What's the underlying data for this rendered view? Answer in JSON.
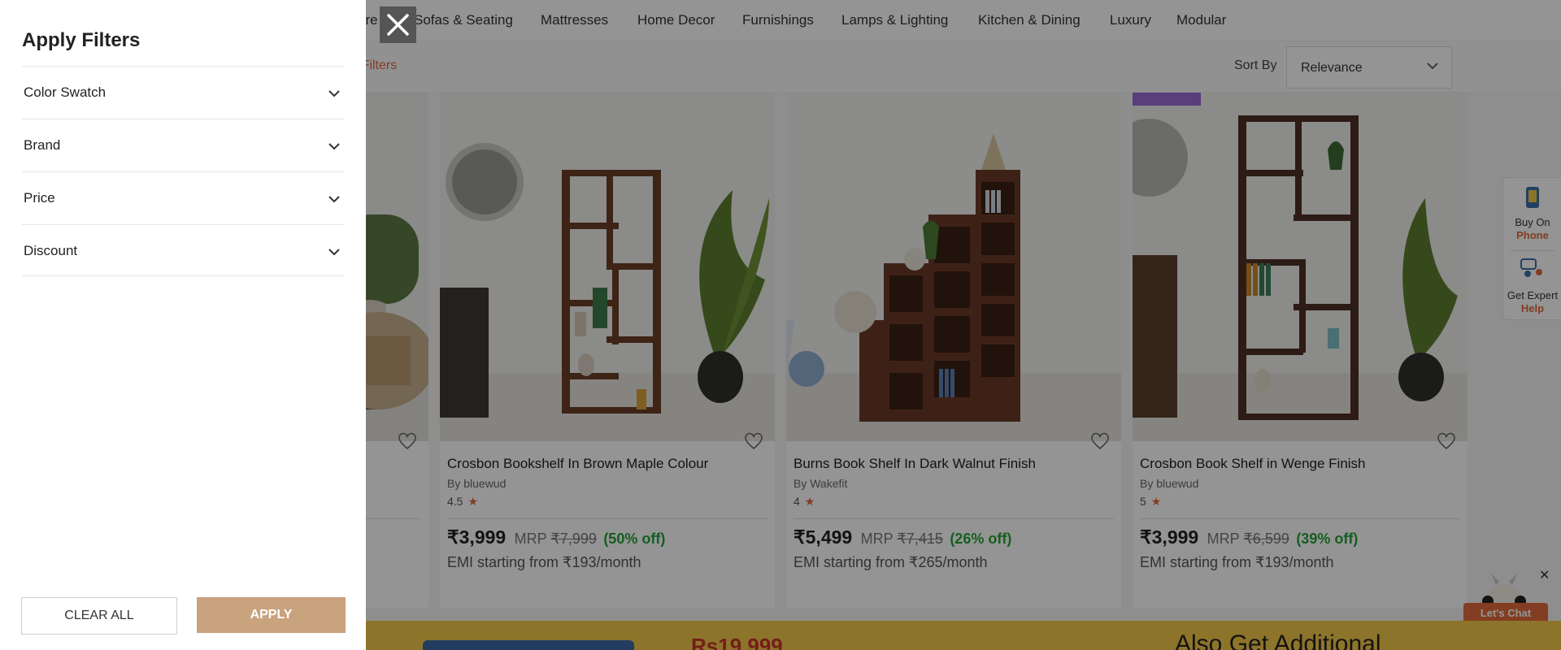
{
  "nav": {
    "items": [
      "ure",
      "Sofas & Seating",
      "Mattresses",
      "Home Decor",
      "Furnishings",
      "Lamps & Lighting",
      "Kitchen & Dining",
      "Luxury",
      "Modular"
    ]
  },
  "toolbar": {
    "more_filters": "re Filters",
    "sort_by_label": "Sort By",
    "sort_by_value": "Relevance"
  },
  "products": [
    {
      "name": "Crosbon Bookshelf In Brown Maple Colour",
      "brand": "By bluewud",
      "rating": "4.5",
      "price": "₹3,999",
      "mrp_prefix": "MRP",
      "mrp": "₹7,999",
      "discount": "(50% off)",
      "emi": "EMI starting from ₹193/month"
    },
    {
      "name": "Burns Book Shelf In Dark Walnut Finish",
      "brand": "By Wakefit",
      "rating": "4",
      "price": "₹5,499",
      "mrp_prefix": "MRP",
      "mrp": "₹7,415",
      "discount": "(26% off)",
      "emi": "EMI starting from ₹265/month"
    },
    {
      "name": "Crosbon Book Shelf in Wenge Finish",
      "brand": "By bluewud",
      "rating": "5",
      "price": "₹3,999",
      "mrp_prefix": "MRP",
      "mrp": "₹6,599",
      "discount": "(39% off)",
      "emi": "EMI starting from ₹193/month"
    }
  ],
  "side_widget": {
    "buy_line1": "Buy On",
    "buy_line2": "Phone",
    "help_line1": "Get Expert",
    "help_line2": "Help"
  },
  "chat": {
    "label": "Let's Chat",
    "close": "✕"
  },
  "promo": {
    "price": "Rs19,999",
    "text": "Also Get Additional"
  },
  "drawer": {
    "title": "Apply Filters",
    "filters": [
      "Color Swatch",
      "Brand",
      "Price",
      "Discount"
    ],
    "clear_label": "CLEAR ALL",
    "apply_label": "APPLY"
  },
  "icons": {
    "close": "close-icon",
    "chevron": "chevron-down-icon",
    "heart": "heart-icon",
    "star": "star-icon"
  },
  "colors": {
    "accent": "#e2693b",
    "discount": "#27a33a",
    "apply_button": "#c9a27e",
    "overlay": "rgba(0,0,0,0.42)"
  }
}
